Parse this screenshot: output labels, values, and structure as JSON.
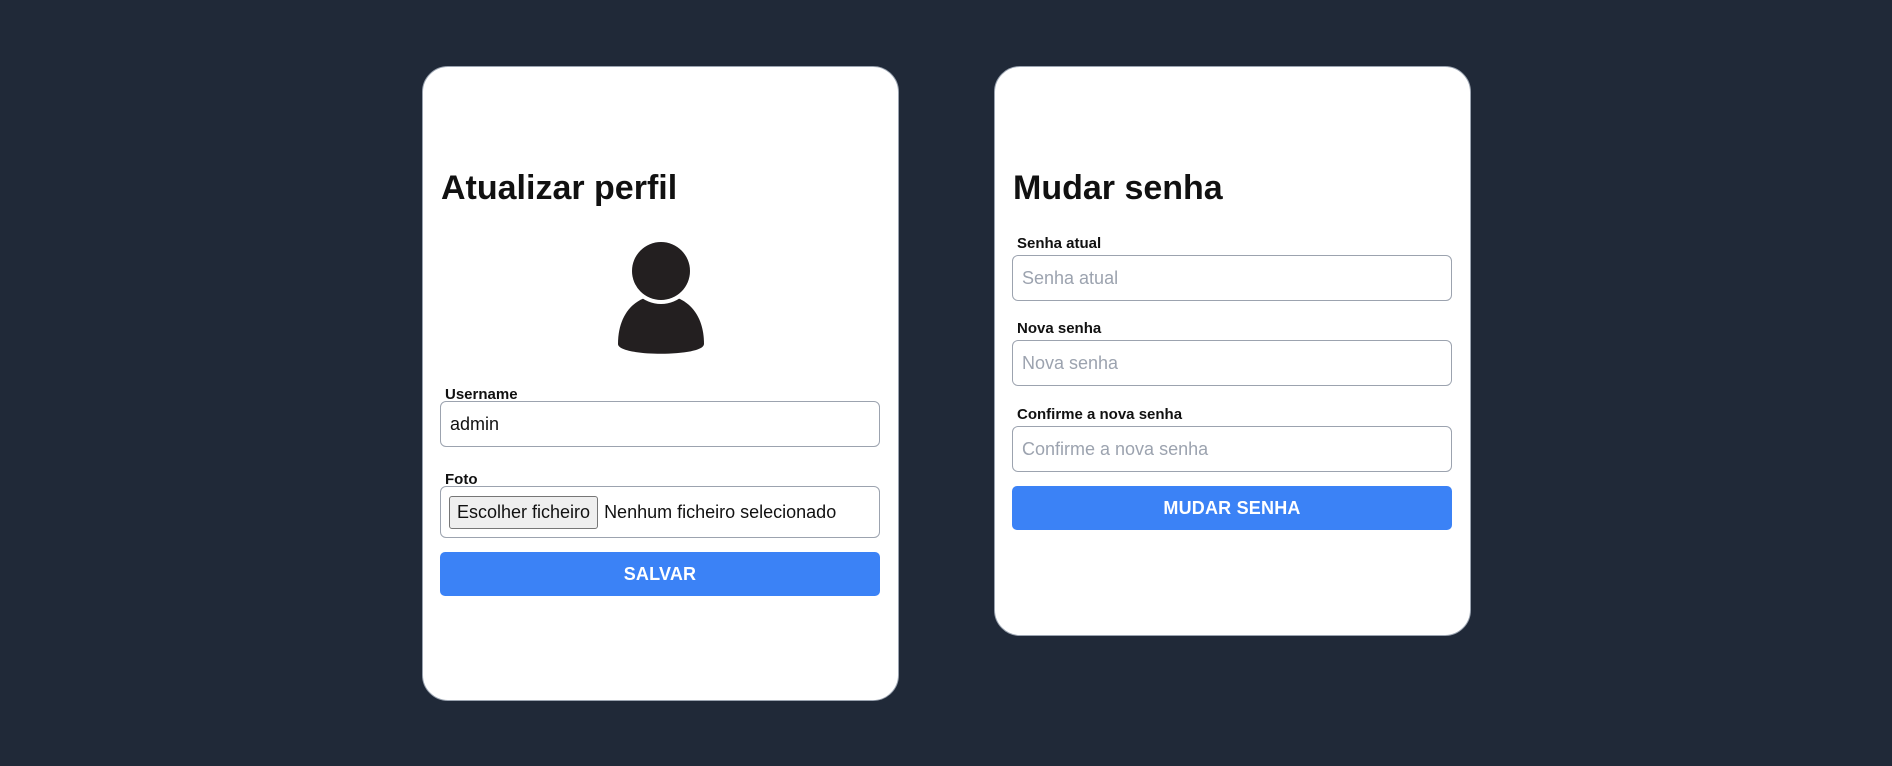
{
  "profile": {
    "title": "Atualizar perfil",
    "avatar_icon": "user-silhouette-icon",
    "username_label": "Username",
    "username_value": "admin",
    "photo_label": "Foto",
    "file_button_label": "Escolher ficheiro",
    "file_status": "Nenhum ficheiro selecionado",
    "save_button": "SALVAR"
  },
  "password": {
    "title": "Mudar senha",
    "current_label": "Senha atual",
    "current_placeholder": "Senha atual",
    "new_label": "Nova senha",
    "new_placeholder": "Nova senha",
    "confirm_label": "Confirme a nova senha",
    "confirm_placeholder": "Confirme a nova senha",
    "submit_button": "MUDAR SENHA"
  },
  "colors": {
    "background": "#202938",
    "card": "#ffffff",
    "accent": "#3b82f6",
    "avatar": "#231f20"
  }
}
